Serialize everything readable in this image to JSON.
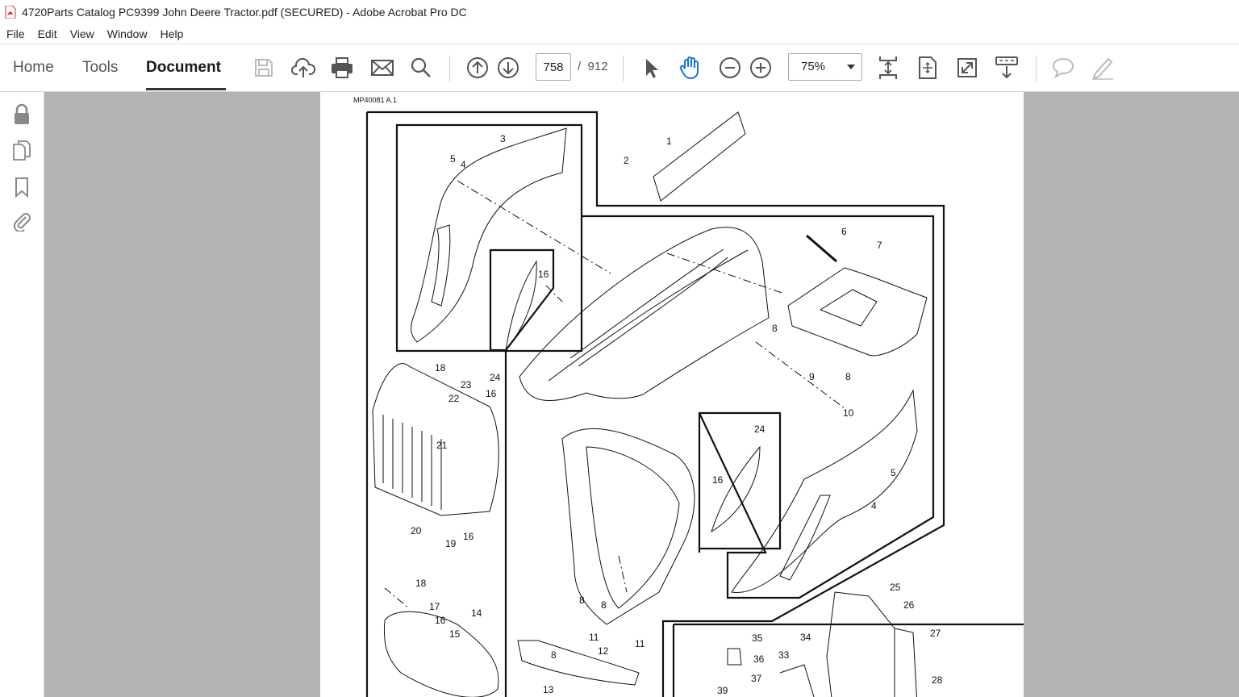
{
  "window": {
    "title": "4720Parts Catalog PC9399 John Deere  Tractor.pdf (SECURED) - Adobe Acrobat Pro DC"
  },
  "menu": [
    "File",
    "Edit",
    "View",
    "Window",
    "Help"
  ],
  "nav_tabs": [
    {
      "label": "Home",
      "active": false
    },
    {
      "label": "Tools",
      "active": false
    },
    {
      "label": "Document",
      "active": true
    }
  ],
  "toolbar": {
    "page_current": "758",
    "page_separator": "/",
    "page_total": "912",
    "zoom": "75%",
    "icons": [
      "save-icon",
      "cloud-upload-icon",
      "print-icon",
      "email-icon",
      "search-icon",
      "previous-page-icon",
      "next-page-icon",
      "select-cursor-icon",
      "hand-tool-icon",
      "zoom-out-icon",
      "zoom-in-icon",
      "scroll-mode-icon",
      "fit-page-icon",
      "full-screen-icon",
      "read-mode-icon",
      "comment-icon",
      "sign-icon"
    ]
  },
  "left_panel": {
    "icons": [
      "lock-icon",
      "pages-icon",
      "bookmark-icon",
      "attachment-icon"
    ]
  },
  "document": {
    "page_label": "MP40081 A.1",
    "callouts": [
      "1",
      "2",
      "3",
      "4",
      "5",
      "16",
      "24",
      "6",
      "7",
      "8",
      "9",
      "8",
      "10",
      "5",
      "4",
      "24",
      "16",
      "18",
      "23",
      "22",
      "16",
      "21",
      "20",
      "19",
      "16",
      "18",
      "17",
      "16",
      "15",
      "14",
      "13",
      "8",
      "8",
      "11",
      "12",
      "11",
      "8",
      "25",
      "26",
      "27",
      "28",
      "35",
      "36",
      "37",
      "39",
      "34",
      "33"
    ]
  },
  "colors": {
    "doc_background": "#b4b4b4",
    "accent_active": "#333333",
    "hand_tool": "#1473e6"
  }
}
